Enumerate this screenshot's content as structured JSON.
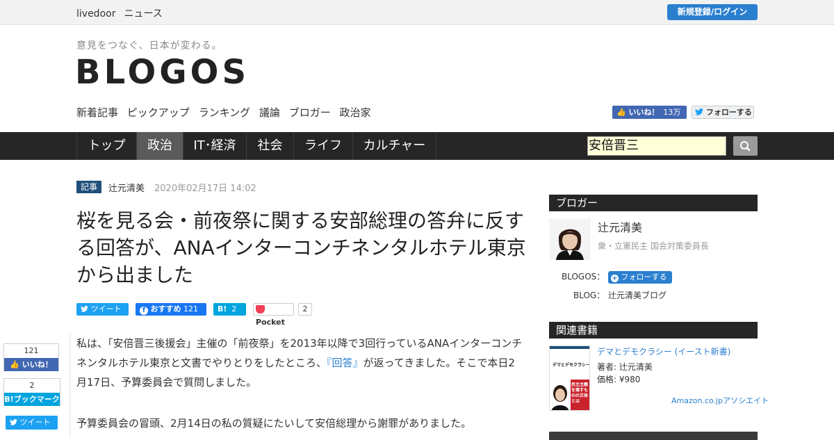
{
  "topbar": {
    "brand": "livedoor",
    "brand_sub": "ニュース",
    "login_label": "新規登録/ログイン"
  },
  "header": {
    "tagline": "意見をつなぐ、日本が変わる。",
    "logo": "BLOGOS",
    "subnav": [
      "新着記事",
      "ピックアップ",
      "ランキング",
      "議論",
      "ブロガー",
      "政治家"
    ],
    "fb_like_label": "いいね！",
    "fb_like_count": "13万",
    "tw_follow_label": "フォローする"
  },
  "mainnav": {
    "tabs": [
      "トップ",
      "政治",
      "IT･経済",
      "社会",
      "ライフ",
      "カルチャー"
    ],
    "active_tab": "政治"
  },
  "search": {
    "value": "安倍晋三",
    "icon": "search-icon"
  },
  "article": {
    "category": "記事",
    "author": "辻元清美",
    "date": "2020年02月17日 14:02",
    "title": "桜を見る会・前夜祭に関する安部総理の答弁に反する回答が、ANAインターコンチネンタルホテル東京から出ました",
    "share": {
      "tweet": "ツイート",
      "fb_label": "おすすめ",
      "fb_count": "121",
      "hatena_label": "B!",
      "hatena_count": "2",
      "pocket_label": "Pocket",
      "pocket_count": "2"
    },
    "p1_before": "私は、「安倍晋三後援会」主催の「前夜祭」を2013年以降で3回行っているANAインターコンチネンタルホテル東京と文書でやりとりをしたところ、",
    "p1_link": "『回答』",
    "p1_after": "が返ってきました。そこで本日2月17日、予算委員会で質問しました。",
    "p2": "予算委員会の冒頭、2月14日の私の質疑にたいして安倍総理から謝罪がありました。"
  },
  "floating_share": {
    "fb_count": "121",
    "fb_label": "いいね！",
    "hatena_count": "2",
    "hatena_label": "B!ブックマーク",
    "tweet_label": "ツイート"
  },
  "sidebar": {
    "blogger_heading": "ブロガー",
    "blogger_name": "辻元清美",
    "blogger_role": "衆・立憲民主 国会対策委員長",
    "blogos_label": "BLOGOS：",
    "follow_label": "フォローする",
    "blog_label": "BLOG：",
    "blog_name": "辻元清美ブログ",
    "books_heading": "関連書籍",
    "book_title": "デマとデモクラシー (イースト新書)",
    "book_author": "著者: 辻元清美",
    "book_price": "価格: ¥980",
    "amazon_label": "Amazon.co.jpアソシエイト",
    "book_cover_title": "デマとデモクラシー",
    "book_cover_text": "民主主義を壊すものの正体とは"
  },
  "colors": {
    "accent": "#2a7fcf",
    "nav_bg": "#262626",
    "active_tab": "#5a5a5a",
    "badge": "#1f4f7a"
  }
}
